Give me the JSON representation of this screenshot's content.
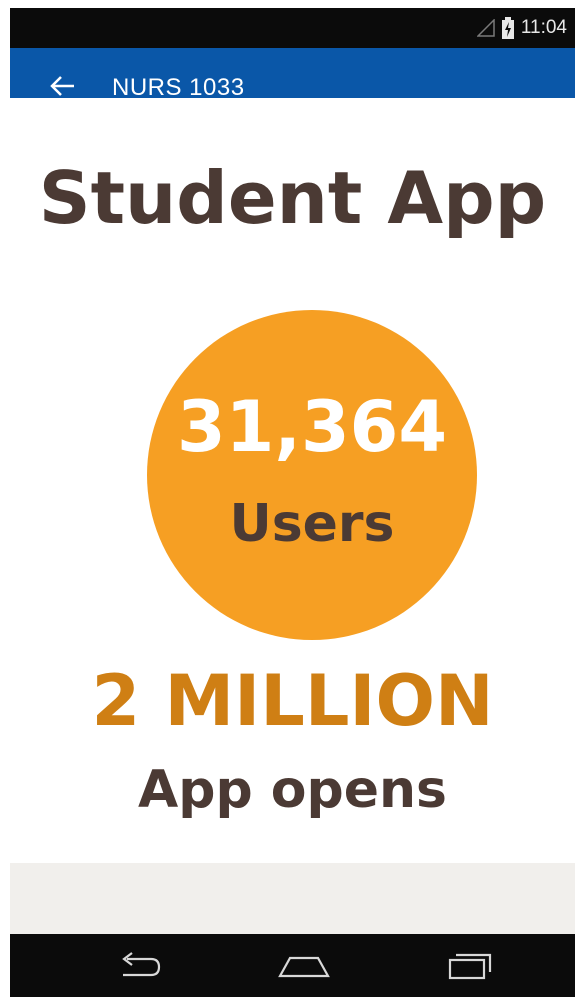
{
  "status_bar": {
    "time": "11:04",
    "icons": [
      "signal-icon",
      "battery-charging-icon"
    ]
  },
  "app_bar": {
    "back_icon": "arrow-left-icon",
    "title": "NURS 1033"
  },
  "slide": {
    "title": "Student App",
    "users": {
      "count": "31,364",
      "label": "Users"
    },
    "opens": {
      "count": "2 MILLION",
      "label": "App opens"
    }
  },
  "nav_bar": {
    "icons": [
      "back-icon",
      "home-icon",
      "recents-icon"
    ]
  },
  "colors": {
    "app_bar": "#0a57a8",
    "circle": "#f69f23",
    "dark_text": "#4b3a34",
    "orange_text": "#cf7f14"
  }
}
